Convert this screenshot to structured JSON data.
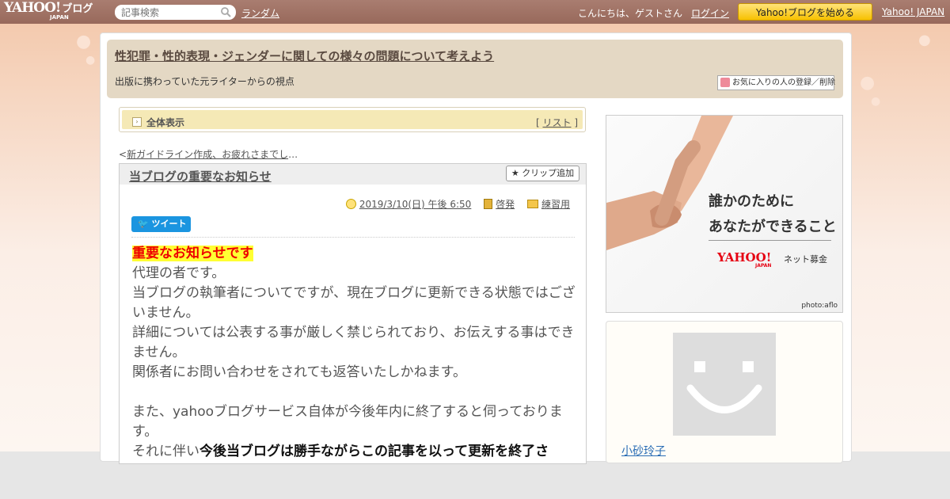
{
  "topbar": {
    "logo_text": "YAHOO!",
    "logo_sub": "JAPAN",
    "logo_blog": "ブログ",
    "search_placeholder": "記事検索",
    "random_label": "ランダム",
    "greeting": "こんにちは、ゲストさん",
    "login_label": "ログイン",
    "start_blog_label": "Yahoo!ブログを始める",
    "yahoo_japan_label": "Yahoo! JAPAN"
  },
  "blog": {
    "title": "性犯罪・性的表現・ジェンダーに関しての様々の問題について考えよう",
    "description": "出版に携わっていた元ライターからの視点",
    "favorite_label": "お気に入りの人の登録／削除"
  },
  "listbar": {
    "all_view_label": "全体表示",
    "list_open": "[ ",
    "list_label": "リスト",
    "list_close": " ]"
  },
  "prev_link": {
    "prefix": "<",
    "label": "新ガイドライン作成、お疲れさまでし",
    "suffix": "…"
  },
  "article": {
    "title": "当ブログの重要なお知らせ",
    "clip_label": "クリップ追加",
    "datetime": "2019/3/10(日) 午後 6:50",
    "category": "啓発",
    "folder": "練習用",
    "tweet_label": "ツイート",
    "headline": "重要なお知らせです",
    "lines": [
      "代理の者です。",
      "当ブログの執筆者についてですが、現在ブログに更新できる状態ではございません。",
      "詳細については公表する事が厳しく禁じられており、お伝えする事はできません。",
      "関係者にお問い合わせをされても返答いたしかねます。",
      "",
      "また、yahooブログサービス自体が今後年内に終了すると伺っております。"
    ],
    "last_prefix": "それに伴い",
    "last_bold": "今後当ブログは勝手ながらこの記事を以って更新を終了さ"
  },
  "ad": {
    "line1": "誰かのために",
    "line2": "あなたができること",
    "logo": "YAHOO!",
    "logo_sub": "JAPAN",
    "service": "ネット募金",
    "credit": "photo:aflo"
  },
  "profile": {
    "name": "小砂玲子"
  },
  "colors": {
    "topbar": "#a97d70",
    "header_bg": "#e4d8c4",
    "listbar_bg": "#f5e9b6",
    "highlight_bg": "#ffff33",
    "highlight_text": "#ee0000",
    "start_button": "#ffc800"
  }
}
